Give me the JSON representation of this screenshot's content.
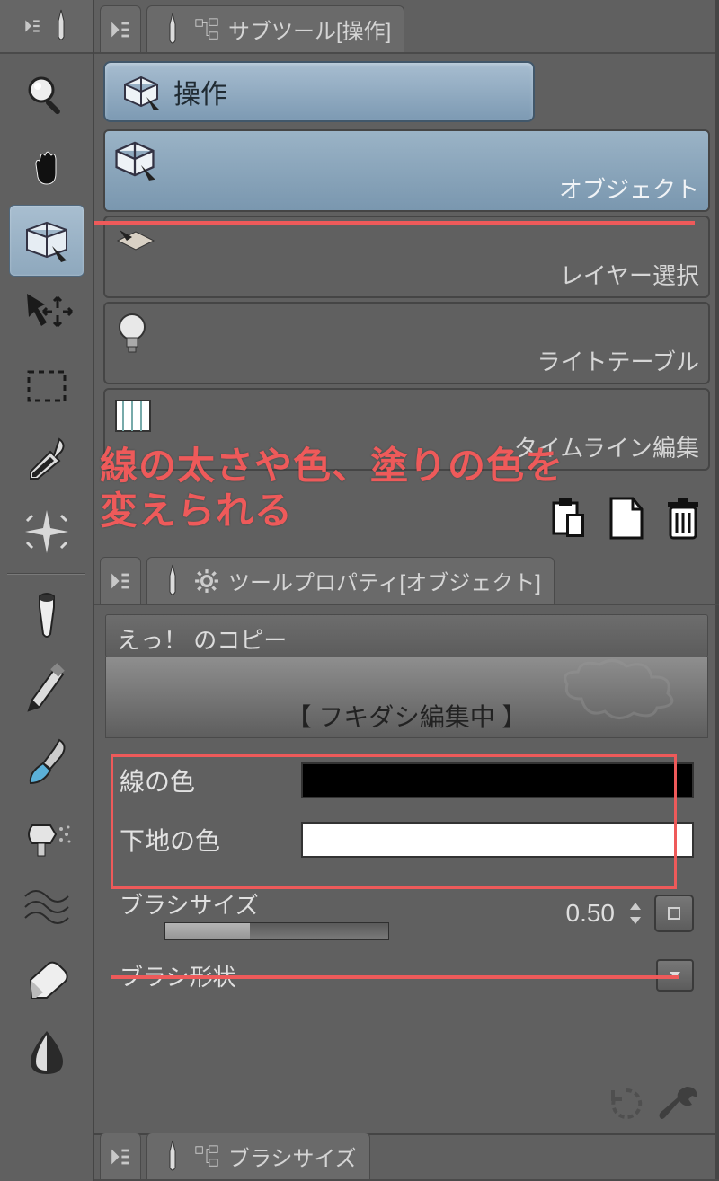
{
  "sidebar": {
    "tools": [
      {
        "name": "magnifier-icon"
      },
      {
        "name": "hand-icon"
      },
      {
        "name": "operation-icon"
      },
      {
        "name": "move-icon"
      },
      {
        "name": "marquee-icon"
      },
      {
        "name": "eyedropper-icon"
      },
      {
        "name": "sparkle-icon"
      },
      {
        "name": "marker-icon"
      },
      {
        "name": "pencil-icon"
      },
      {
        "name": "brush-icon"
      },
      {
        "name": "airbrush-icon"
      },
      {
        "name": "decoration-icon"
      },
      {
        "name": "eraser-icon"
      },
      {
        "name": "blend-icon"
      }
    ]
  },
  "subtool_panel": {
    "title": "サブツール[操作]",
    "group_label": "操作",
    "items": [
      {
        "label": "オブジェクト"
      },
      {
        "label": "レイヤー選択"
      },
      {
        "label": "ライトテーブル"
      },
      {
        "label": "タイムライン編集"
      }
    ]
  },
  "annotation": {
    "line1": "線の太さや色、塗りの色を",
    "line2": "変えられる"
  },
  "property_panel": {
    "title": "ツールプロパティ[オブジェクト]",
    "object_name": "えっ！ のコピー",
    "status": "【 フキダシ編集中 】",
    "line_color_label": "線の色",
    "line_color_value": "#000000",
    "fill_color_label": "下地の色",
    "fill_color_value": "#ffffff",
    "brush_size_label": "ブラシサイズ",
    "brush_size_value": "0.50",
    "brush_shape_label": "ブラシ形状"
  },
  "brushsize_panel": {
    "title": "ブラシサイズ"
  }
}
